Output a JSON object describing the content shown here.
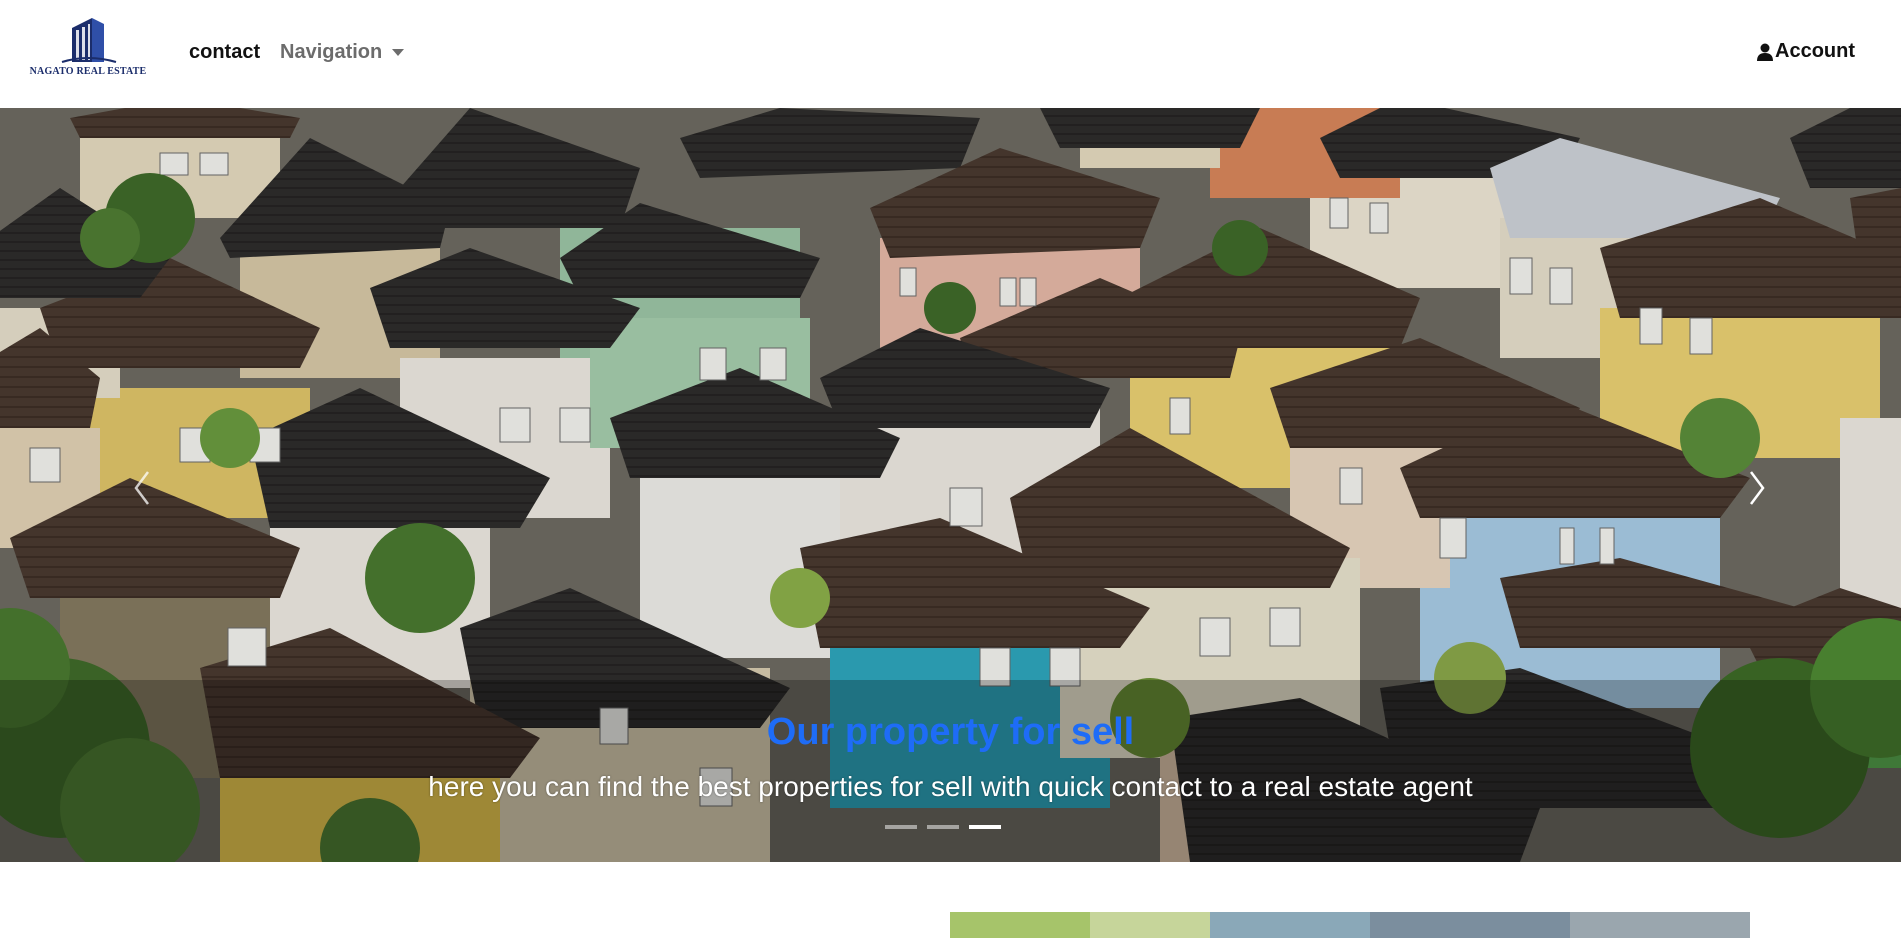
{
  "navbar": {
    "brand": {
      "name": "NAGATO REAL ESTATE",
      "logo_icon": "building-logo-icon",
      "color": "#1b2d6b"
    },
    "links": [
      {
        "label": "contact"
      },
      {
        "label": "Navigation",
        "icon": "caret-down-icon"
      }
    ],
    "account": {
      "label": "Account",
      "icon": "user-icon"
    }
  },
  "carousel": {
    "slide_image": "aerial-houses-neighborhood",
    "caption": {
      "title": "Our property for sell",
      "subtitle": "here you can find the best properties for sell with quick contact to a real estate agent",
      "title_color": "#1e6cf7"
    },
    "indicators_count": 3,
    "active_indicator": 2,
    "prev_icon": "chevron-left-icon",
    "next_icon": "chevron-right-icon"
  }
}
